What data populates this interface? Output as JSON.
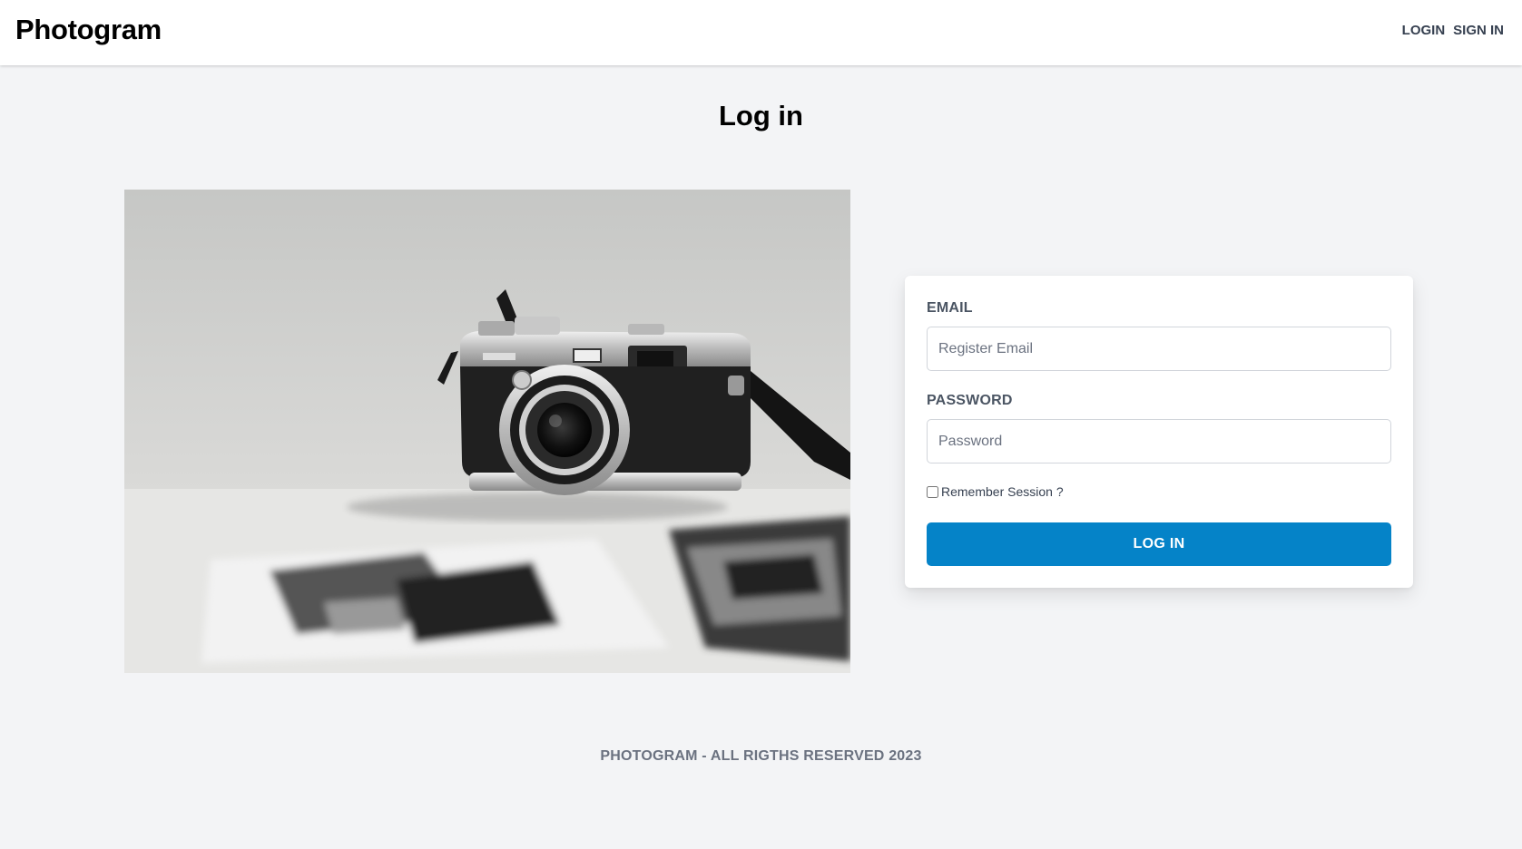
{
  "header": {
    "logo": "Photogram",
    "nav": {
      "login": "LOGIN",
      "sign_in": "SIGN IN"
    }
  },
  "page": {
    "title": "Log in"
  },
  "form": {
    "email": {
      "label": "EMAIL",
      "value": "",
      "placeholder": "Register Email"
    },
    "password": {
      "label": "PASSWORD",
      "value": "",
      "placeholder": "Password"
    },
    "remember": {
      "label": "Remember Session ?",
      "checked": false
    },
    "submit_label": "LOG IN"
  },
  "hero_image": {
    "icon": "camera-photo"
  },
  "footer": {
    "text": "PHOTOGRAM - ALL RIGTHS RESERVED 2023"
  },
  "colors": {
    "background": "#f3f4f6",
    "primary": "#0583c8",
    "header_bg": "#ffffff",
    "label_text": "#4b5563",
    "footer_text": "#6b7280"
  }
}
